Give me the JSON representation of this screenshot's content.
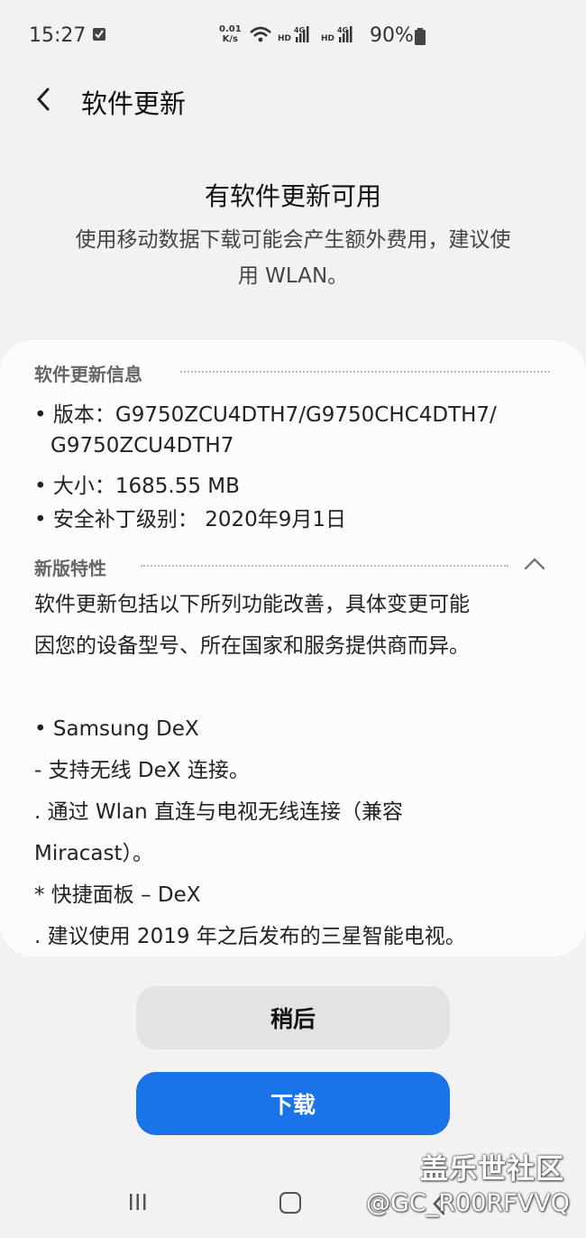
{
  "status_bar": {
    "time": "15:27",
    "net_speed_value": "0.01",
    "net_speed_unit": "K/s",
    "battery": "90%"
  },
  "header": {
    "title": "软件更新"
  },
  "summary": {
    "headline": "有软件更新可用",
    "description_line1": "使用移动数据下载可能会产生额外费用，建议使",
    "description_line2": "用 WLAN。"
  },
  "update_info": {
    "heading": "软件更新信息",
    "version_line1": "• 版本：G9750ZCU4DTH7/G9750CHC4DTH7/",
    "version_line2": "G9750ZCU4DTH7",
    "size": "• 大小：1685.55 MB",
    "security_patch": "• 安全补丁级别： 2020年9月1日"
  },
  "whats_new": {
    "heading": "新版特性",
    "lines": [
      "软件更新包括以下所列功能改善，具体变更可能",
      "因您的设备型号、所在国家和服务提供商而异。",
      "",
      "• Samsung DeX",
      " - 支持无线 DeX 连接。",
      "  . 通过 Wlan 直连与电视无线连接（兼容",
      "Miracast）。",
      " * 快捷面板 – DeX",
      "  . 建议使用 2019 年之后发布的三星智能电视。"
    ]
  },
  "actions": {
    "later_label": "稍后",
    "download_label": "下载"
  },
  "watermark": {
    "line1": "盖乐世社区",
    "line2": "@GC_R00RFVVQ"
  },
  "colors": {
    "accent": "#1a73e8",
    "background": "#f2f2f2",
    "card": "#fcfcfc",
    "secondary_button": "#e3e3e3"
  }
}
